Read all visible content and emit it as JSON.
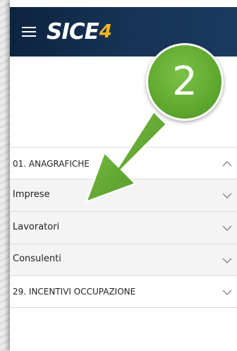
{
  "header": {
    "logo_text": "SICE",
    "logo_suffix": "4"
  },
  "badge": {
    "number": "2",
    "color": "#5fa82e"
  },
  "menu": {
    "section_anagrafiche": "01. ANAGRAFICHE",
    "items": [
      {
        "label": "Imprese"
      },
      {
        "label": "Lavoratori"
      },
      {
        "label": "Consulenti"
      }
    ],
    "section_incentivi": "29. INCENTIVI OCCUPAZIONE"
  },
  "icons": {
    "menu": "hamburger-icon",
    "expanded": "chevron-up-icon",
    "collapsed": "chevron-down-icon"
  }
}
